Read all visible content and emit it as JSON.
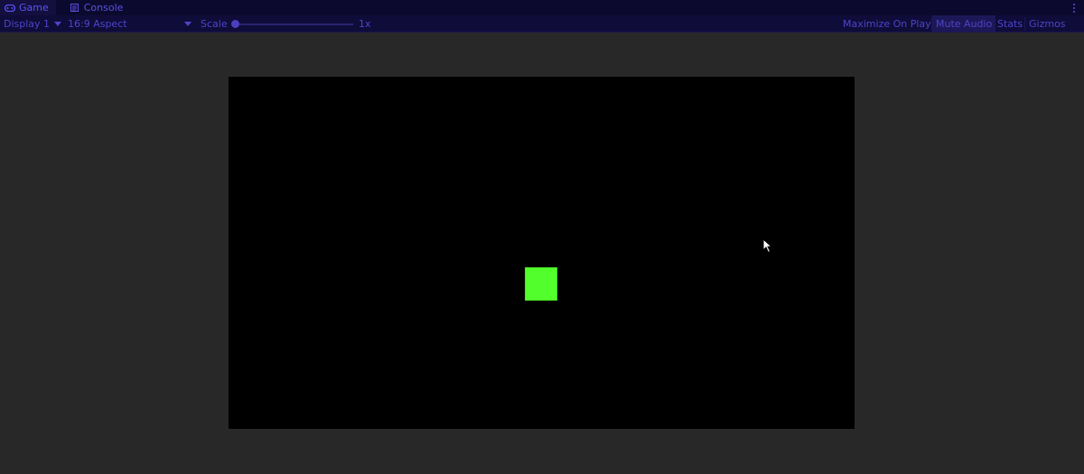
{
  "tabs": [
    {
      "label": "Game",
      "icon": "gamepad-icon",
      "active": true
    },
    {
      "label": "Console",
      "icon": "console-icon",
      "active": false
    }
  ],
  "toolbar": {
    "display": {
      "value": "Display 1"
    },
    "aspect": {
      "value": "16:9 Aspect"
    },
    "scale": {
      "label": "Scale",
      "value": "1x",
      "level": 0
    },
    "buttons": {
      "maximize_on_play": {
        "label": "Maximize On Play",
        "on": false
      },
      "mute_audio": {
        "label": "Mute Audio",
        "on": true
      },
      "stats": {
        "label": "Stats",
        "on": false
      },
      "gizmos": {
        "label": "Gizmos",
        "on": false
      }
    }
  },
  "game": {
    "background": "#000000",
    "player_color": "#52ff2c"
  },
  "colors": {
    "editor_bg": "#282828",
    "tabbar_bg": "#0b0a2e",
    "toolbar_bg": "#0f0c3a",
    "accent_text": "#5c4fe0"
  }
}
